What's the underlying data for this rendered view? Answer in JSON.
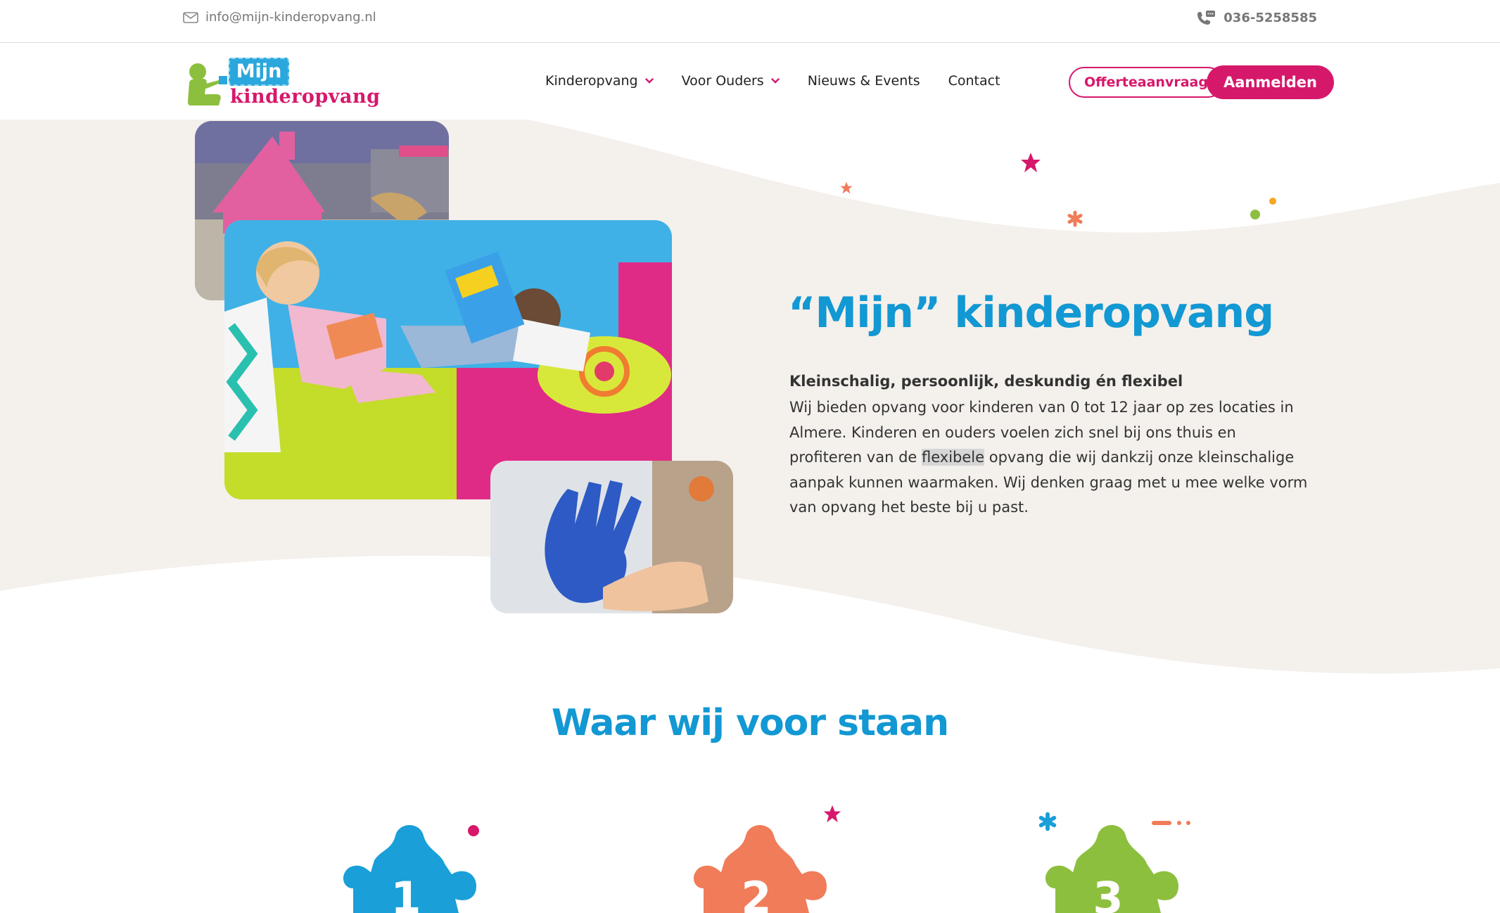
{
  "topbar": {
    "email": "info@mijn-kinderopvang.nl",
    "phone": "036-5258585"
  },
  "logo": {
    "line1": "Mijn",
    "line2": "kinderopvang"
  },
  "nav": {
    "items": [
      {
        "label": "Kinderopvang"
      },
      {
        "label": "Voor Ouders"
      },
      {
        "label": "Nieuws & Events"
      },
      {
        "label": "Contact"
      }
    ]
  },
  "header": {
    "quote_button": "Offerteaanvraag",
    "signup_button": "Aanmelden"
  },
  "hero": {
    "title": "“Mijn” kinderopvang",
    "subtitle": "Kleinschalig, persoonlijk, deskundig én flexibel",
    "text_before": "Wij bieden opvang voor kinderen van 0 tot 12 jaar op zes locaties in Almere. Kinderen en ouders voelen zich snel bij ons thuis en profiteren van de ",
    "text_highlight": "flexibele",
    "text_after": " opvang die wij dankzij onze kleinschalige aanpak kunnen waarmaken. Wij denken graag met u mee welke vorm van opvang het beste bij u past."
  },
  "values": {
    "title": "Waar wij voor staan",
    "items": [
      {
        "number": "1"
      },
      {
        "number": "2"
      },
      {
        "number": "3"
      }
    ]
  },
  "colors": {
    "brand_pink": "#d6186b",
    "brand_blue": "#1298d3",
    "brand_orange": "#f07c5a",
    "brand_green": "#8dbf3f",
    "hero_bg": "#f4f0ec"
  }
}
